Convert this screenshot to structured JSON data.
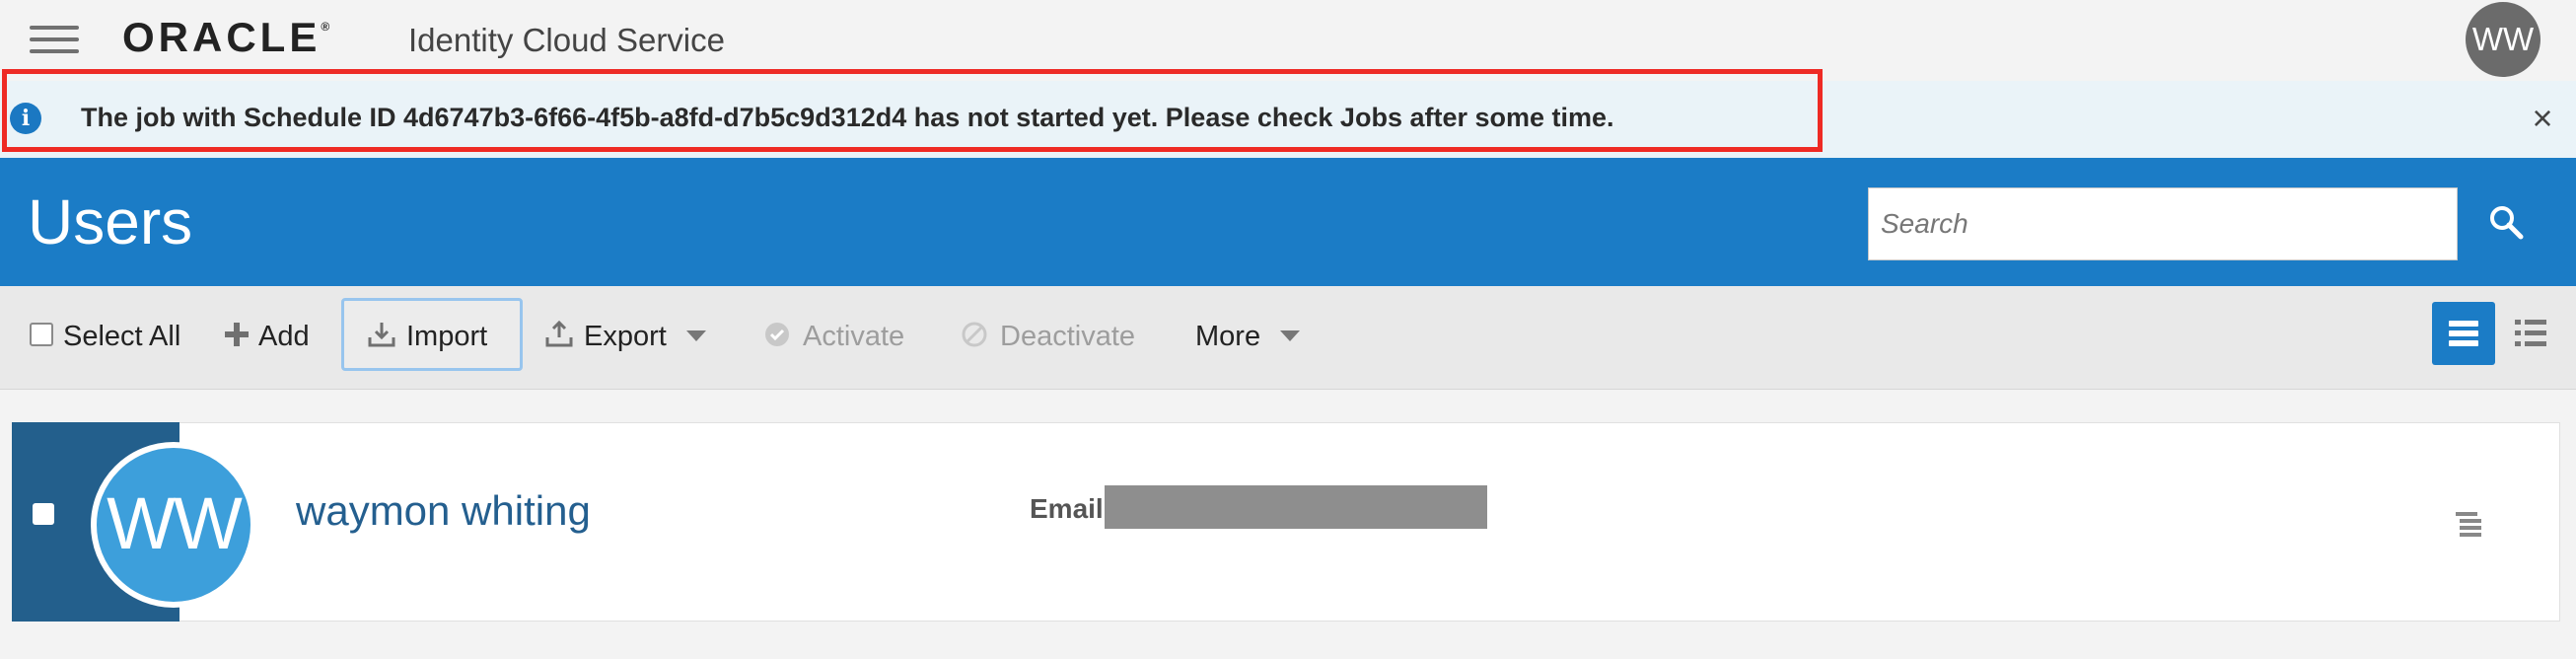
{
  "topbar": {
    "logo_text": "ORACLE",
    "logo_mark": "®",
    "product_name": "Identity Cloud Service",
    "user_initials": "WW",
    "menu_icon": "hamburger-icon"
  },
  "notification": {
    "icon": "info-icon",
    "icon_glyph": "i",
    "message": "The job with Schedule ID 4d6747b3-6f66-4f5b-a8fd-d7b5c9d312d4 has not started yet. Please check Jobs after some time.",
    "close_glyph": "×",
    "highlight_color": "#ee2a24"
  },
  "header": {
    "title": "Users",
    "search_placeholder": "Search",
    "search_icon": "search-icon",
    "color": "#1b7cc6"
  },
  "toolbar": {
    "select_all": "Select All",
    "add": "Add",
    "import": "Import",
    "export": "Export",
    "activate": "Activate",
    "deactivate": "Deactivate",
    "more": "More"
  },
  "users": [
    {
      "initials": "WW",
      "name": "waymon whiting",
      "email_label": "Email"
    }
  ]
}
